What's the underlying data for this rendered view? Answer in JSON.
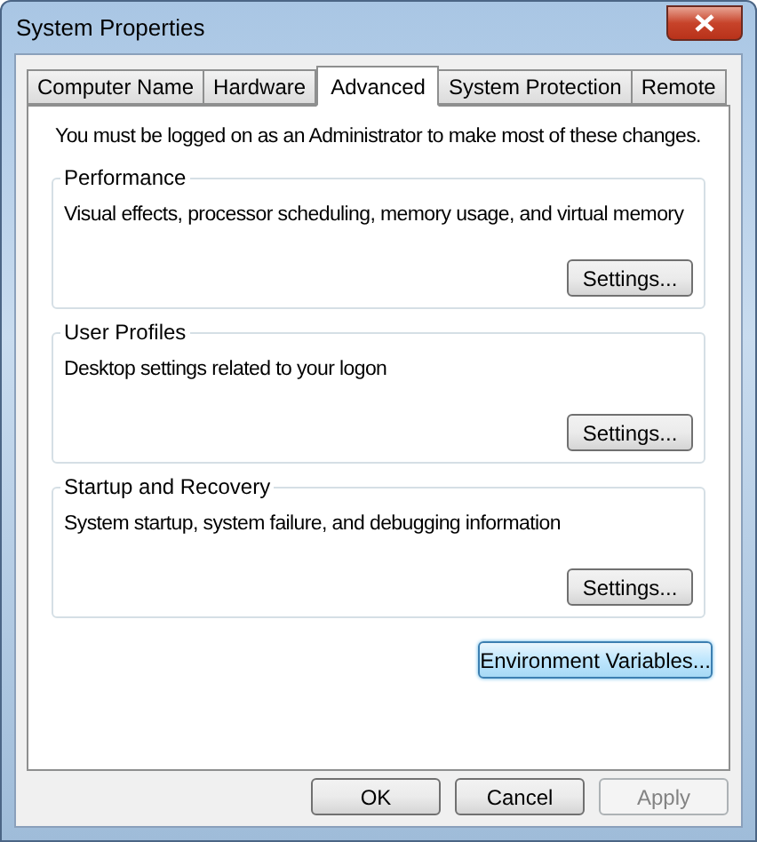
{
  "window": {
    "title": "System Properties"
  },
  "tabs": [
    {
      "label": "Computer Name",
      "selected": false
    },
    {
      "label": "Hardware",
      "selected": false
    },
    {
      "label": "Advanced",
      "selected": true
    },
    {
      "label": "System Protection",
      "selected": false
    },
    {
      "label": "Remote",
      "selected": false
    }
  ],
  "notice": "You must be logged on as an Administrator to make most of these changes.",
  "groups": [
    {
      "title": "Performance",
      "description": "Visual effects, processor scheduling, memory usage, and virtual memory",
      "button": "Settings..."
    },
    {
      "title": "User Profiles",
      "description": "Desktop settings related to your logon",
      "button": "Settings..."
    },
    {
      "title": "Startup and Recovery",
      "description": "System startup, system failure, and debugging information",
      "button": "Settings..."
    }
  ],
  "environment_button": {
    "label": "Environment Variables...",
    "focused": true
  },
  "buttons": [
    {
      "label": "OK",
      "disabled": false
    },
    {
      "label": "Cancel",
      "disabled": false
    },
    {
      "label": "Apply",
      "disabled": true
    }
  ]
}
